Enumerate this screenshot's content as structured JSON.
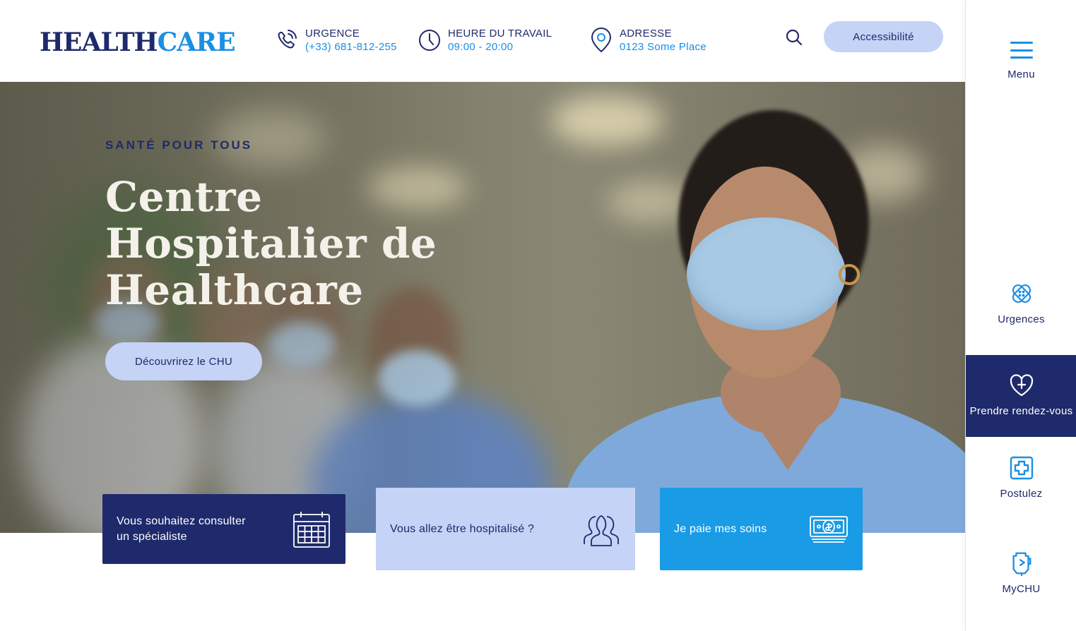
{
  "header": {
    "logo": {
      "part1": "HEALTH",
      "part2": "CARE"
    },
    "urgence": {
      "label": "URGENCE",
      "value": "(+33) 681-812-255"
    },
    "heure": {
      "label": "HEURE DU TRAVAIL",
      "value": "09:00 - 20:00"
    },
    "adresse": {
      "label": "ADRESSE",
      "value": "0123 Some Place"
    },
    "accessibility_label": "Accessibilité"
  },
  "hero": {
    "tagline": "SANTÉ POUR TOUS",
    "title": "Centre Hospitalier de Healthcare",
    "cta_label": "Découvrirez le CHU"
  },
  "cards": [
    {
      "label": "Vous souhaitez consulter\n un spécialiste",
      "icon": "calendar-icon"
    },
    {
      "label": "Vous allez être hospitalisé ?",
      "icon": "group-icon"
    },
    {
      "label": "Je paie mes soins",
      "icon": "money-icon"
    }
  ],
  "sidebar": {
    "menu_label": "Menu",
    "items": [
      {
        "label": "Urgences",
        "icon": "bandage-icon"
      },
      {
        "label": "Prendre rendez-vous",
        "icon": "heart-plus-icon"
      },
      {
        "label": "Postulez",
        "icon": "medical-cross-icon"
      },
      {
        "label": "MyCHU",
        "icon": "iv-bag-icon"
      }
    ]
  },
  "colors": {
    "navy": "#1e2a6b",
    "accent_blue": "#1a8fe3",
    "light_blue": "#c4d3f6",
    "card_blue": "#1a9be6"
  }
}
